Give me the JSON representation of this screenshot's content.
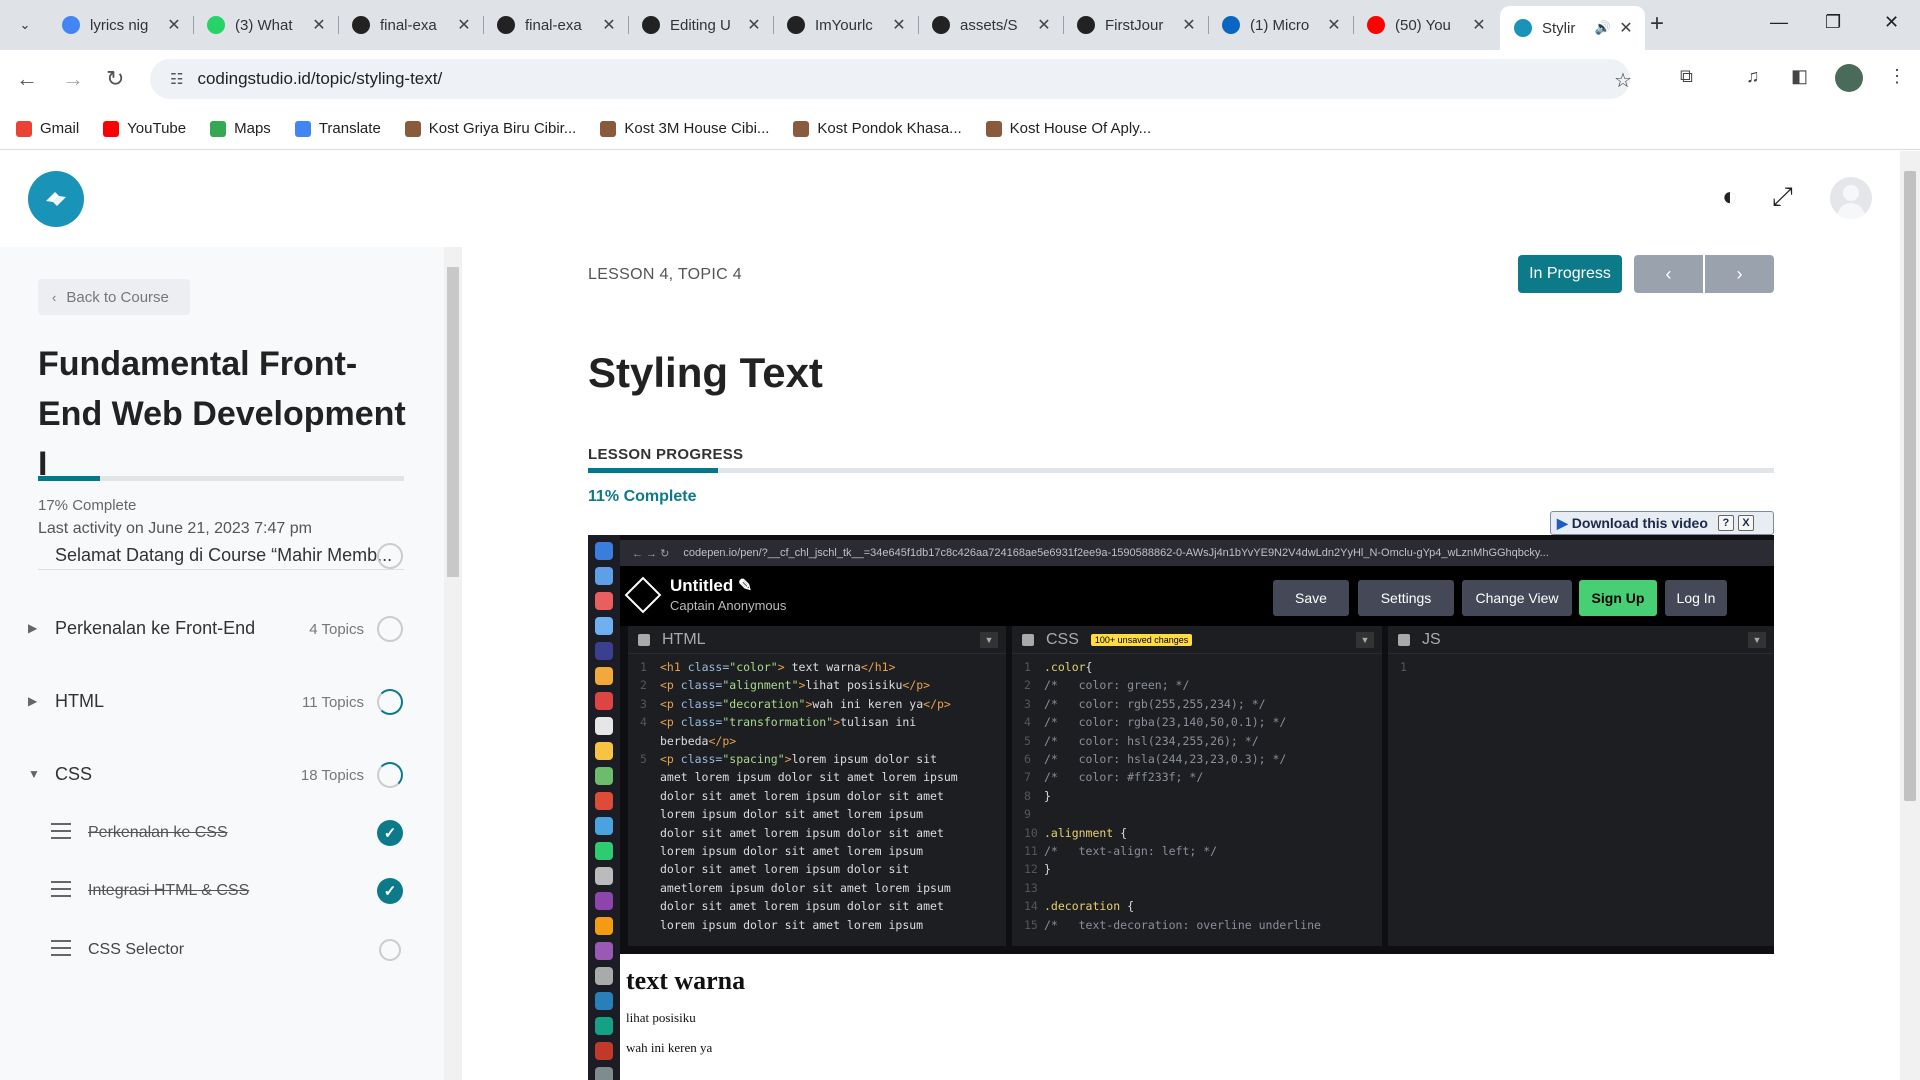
{
  "browser": {
    "tabs": [
      {
        "title": "lyrics nig",
        "icon": "google-icon",
        "color": "#4285f4"
      },
      {
        "title": "(3) What",
        "icon": "whatsapp-icon",
        "color": "#25d366"
      },
      {
        "title": "final-exa",
        "icon": "github-icon",
        "color": "#222222"
      },
      {
        "title": "final-exa",
        "icon": "github-icon",
        "color": "#222222"
      },
      {
        "title": "Editing U",
        "icon": "github-icon",
        "color": "#222222"
      },
      {
        "title": "ImYourlc",
        "icon": "github-icon",
        "color": "#222222"
      },
      {
        "title": "assets/S",
        "icon": "github-icon",
        "color": "#222222"
      },
      {
        "title": "FirstJour",
        "icon": "github-icon",
        "color": "#222222"
      },
      {
        "title": "(1) Micro",
        "icon": "linkedin-icon",
        "color": "#0a66c2"
      },
      {
        "title": "(50) You",
        "icon": "youtube-icon",
        "color": "#ff0000"
      },
      {
        "title": "Stylir",
        "icon": "codingstudio-icon",
        "color": "#1a93b8",
        "active": true
      }
    ],
    "url": "codingstudio.id/topic/styling-text/",
    "bookmarks": [
      {
        "label": "Gmail",
        "icon": "gmail-icon",
        "color": "#ea4335"
      },
      {
        "label": "YouTube",
        "icon": "youtube-icon",
        "color": "#ff0000"
      },
      {
        "label": "Maps",
        "icon": "google-icon",
        "color": "#34a853"
      },
      {
        "label": "Translate",
        "icon": "translate-icon",
        "color": "#4285f4"
      },
      {
        "label": "Kost Griya Biru Cibir...",
        "icon": "kost-icon",
        "color": "#8a5a3c"
      },
      {
        "label": "Kost 3M House Cibi...",
        "icon": "kost-icon",
        "color": "#8a5a3c"
      },
      {
        "label": "Kost Pondok Khasa...",
        "icon": "kost-icon",
        "color": "#8a5a3c"
      },
      {
        "label": "Kost House Of Aply...",
        "icon": "kost-icon",
        "color": "#8a5a3c"
      }
    ]
  },
  "sidebar": {
    "back_label": "Back to Course",
    "course_title": "Fundamental Front-End Web Development I",
    "progress_fraction": 0.17,
    "progress_text": "17% Complete",
    "last_activity": "Last activity on June 21, 2023 7:47 pm",
    "lessons": [
      {
        "name": "Selamat Datang di Course “Mahir Memb...",
        "count": "",
        "expander": "",
        "status": "empty"
      },
      {
        "name": "Perkenalan ke Front-End",
        "count": "4 Topics",
        "expander": "▶",
        "status": "empty"
      },
      {
        "name": "HTML",
        "count": "11 Topics",
        "expander": "▶",
        "status": "partial-high"
      },
      {
        "name": "CSS",
        "count": "18 Topics",
        "expander": "▼",
        "status": "partial-low"
      }
    ],
    "topics": [
      {
        "name": "Perkenalan ke CSS",
        "done": true
      },
      {
        "name": "Integrasi HTML & CSS",
        "done": true
      },
      {
        "name": "CSS Selector",
        "done": false
      }
    ]
  },
  "main": {
    "breadcrumb": "LESSON 4, TOPIC 4",
    "status_button": "In Progress",
    "prev_label": "‹",
    "next_label": "›",
    "title": "Styling Text",
    "progress_label": "LESSON PROGRESS",
    "progress_fraction": 0.11,
    "progress_text": "11% Complete"
  },
  "video": {
    "download_label": "Download this video",
    "help_label": "?",
    "close_label": "X",
    "url": "codepen.io/pen/?__cf_chl_jschl_tk__=34e645f1db17c8c426aa724168ae5e6931f2ee9a-1590588862-0-AWsJj4n1bYvYE9N2V4dwLdn2YyHl_N-Omclu-gYp4_wLznMhGGhqbcky...",
    "codepen": {
      "title": "Untitled",
      "author": "Captain Anonymous",
      "buttons": [
        "Save",
        "Settings",
        "Change View",
        "Sign Up",
        "Log In"
      ]
    },
    "panes": {
      "html_label": "HTML",
      "css_label": "CSS",
      "css_badge": "100+ unsaved changes",
      "js_label": "JS"
    },
    "result": {
      "heading": "text warna",
      "line1": "lihat posisiku",
      "line2": "wah ini keren ya"
    }
  }
}
